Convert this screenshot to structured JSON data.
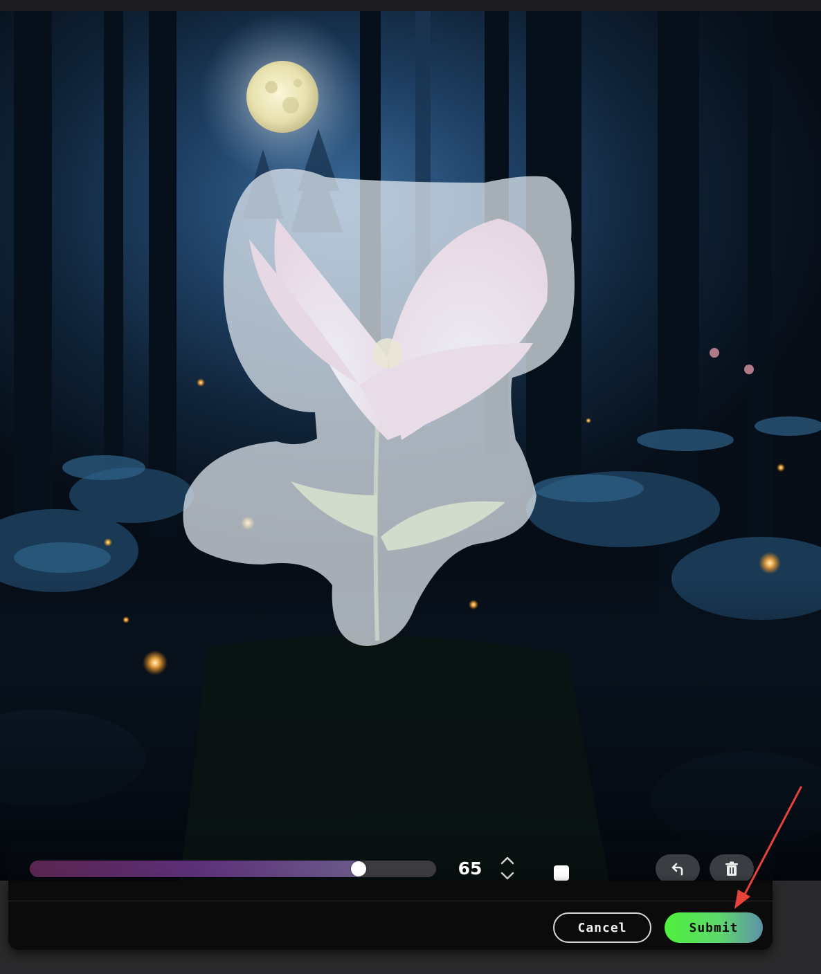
{
  "editor": {
    "brush_size": {
      "value": 65,
      "display": "65",
      "min": 0,
      "max": 100,
      "fill_fraction": 0.81
    },
    "brush_color": "#ffffff",
    "toolbar": {
      "undo_icon": "undo-arrow-icon",
      "delete_icon": "trash-icon"
    }
  },
  "actions": {
    "cancel_label": "Cancel",
    "submit_label": "Submit"
  },
  "colors": {
    "submit_gradient_start": "#4ef03c",
    "submit_gradient_end": "#5d92a8",
    "slider_fill": "#5c2f78",
    "annotation_arrow": "#e8433a"
  }
}
